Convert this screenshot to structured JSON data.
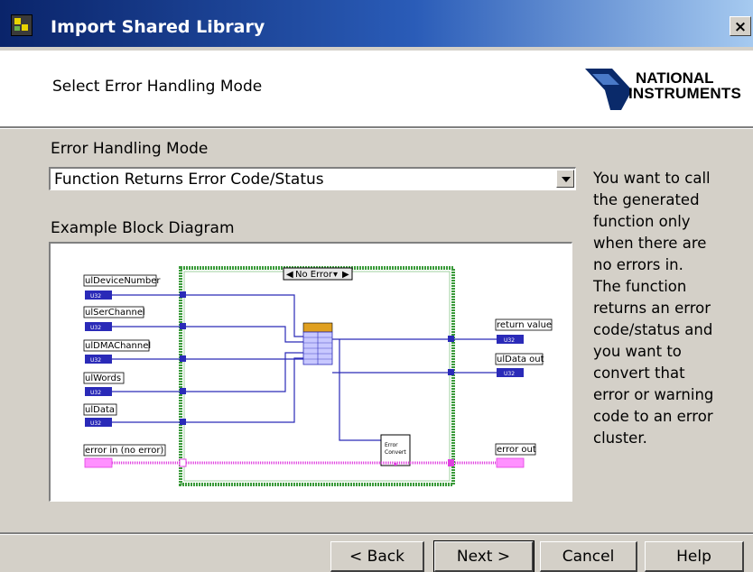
{
  "window": {
    "title": "Import Shared Library",
    "close_label": "×"
  },
  "header": {
    "subtitle": "Select Error Handling Mode",
    "logo_line1": "NATIONAL",
    "logo_line2": "INSTRUMENTS"
  },
  "form": {
    "mode_label": "Error Handling Mode",
    "mode_value": "Function Returns Error Code/Status",
    "diagram_label": "Example Block Diagram"
  },
  "help_lines": [
    "You want to call",
    "the generated",
    "function only",
    "when there are",
    "no errors in.",
    "The function",
    "returns an error",
    "code/status and",
    "you want to",
    "convert that",
    "error or warning",
    "code to an error",
    "cluster."
  ],
  "diagram": {
    "case_selector": "No Error",
    "inputs": [
      {
        "label": "ulDeviceNumber",
        "type": "U32"
      },
      {
        "label": "ulSerChannel",
        "type": "U32"
      },
      {
        "label": "ulDMAChannel",
        "type": "U32"
      },
      {
        "label": "ulWords",
        "type": "U32"
      },
      {
        "label": "ulData",
        "type": "U32"
      }
    ],
    "error_in": "error in (no error)",
    "outputs": [
      {
        "label": "return value",
        "type": "U32"
      },
      {
        "label": "ulData out",
        "type": "U32"
      }
    ],
    "error_out": "error out",
    "convert_line1": "Error",
    "convert_line2": "Convert",
    "colors": {
      "u32_wire": "#2a2ab8",
      "error_wire": "#e040e0",
      "case_border": "#3a9a3a"
    }
  },
  "buttons": {
    "back": "< Back",
    "next": "Next >",
    "cancel": "Cancel",
    "help": "Help"
  }
}
